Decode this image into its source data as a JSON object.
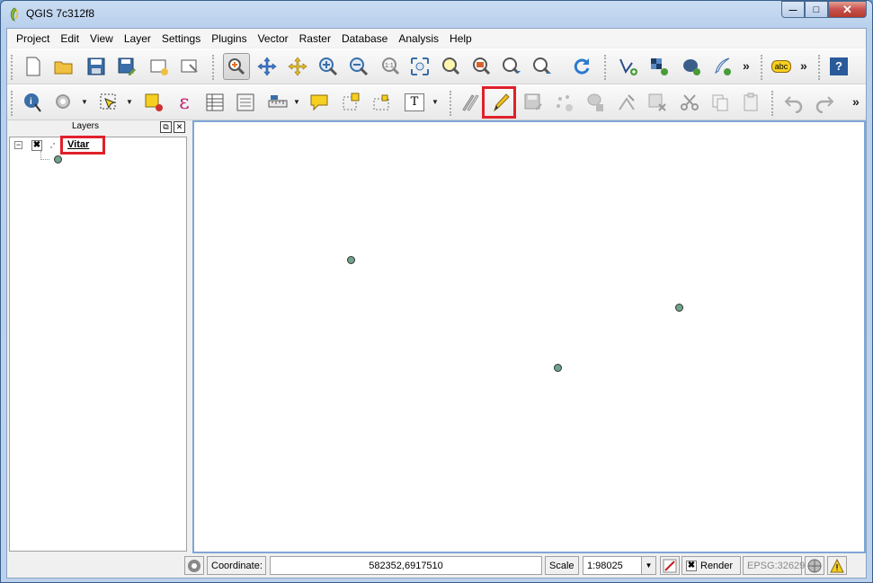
{
  "window": {
    "title": "QGIS 7c312f8",
    "min_glyph": "—",
    "max_glyph": "□",
    "close_glyph": "✕"
  },
  "menu": [
    "Project",
    "Edit",
    "View",
    "Layer",
    "Settings",
    "Plugins",
    "Vector",
    "Raster",
    "Database",
    "Analysis",
    "Help"
  ],
  "toolbar1": {
    "overflow_glyph": "»",
    "label_icon_text": "abc",
    "help_icon_text": "?",
    "buttons": [
      "new-project-icon",
      "open-project-icon",
      "save-project-icon",
      "save-as-icon",
      "new-print-composer-icon",
      "composer-manager-icon",
      "pan-map-icon",
      "pan-to-selection-icon",
      "zoom-in-icon",
      "zoom-out-icon",
      "zoom-actual-size-icon",
      "zoom-full-icon",
      "zoom-to-selection-icon",
      "zoom-to-layer-icon",
      "zoom-last-icon",
      "zoom-next-icon",
      "refresh-icon",
      "add-vector-layer-icon",
      "add-raster-layer-icon",
      "add-postgis-layer-icon",
      "new-shapefile-layer-icon",
      "label-tool-icon",
      "help-icon"
    ]
  },
  "toolbar2": {
    "overflow_glyph": "»",
    "text_icon_glyph": "T",
    "expression_glyph": "ε",
    "highlighted_button": "toggle-editing-icon",
    "buttons": [
      "identify-features-icon",
      "run-feature-action-icon",
      "select-features-icon",
      "deselect-all-icon",
      "select-by-expression-icon",
      "open-attribute-table-icon",
      "field-calculator-icon",
      "measure-icon",
      "map-tips-icon",
      "new-bookmark-icon",
      "show-bookmarks-icon",
      "text-annotation-icon",
      "current-edits-icon",
      "toggle-editing-icon",
      "save-layer-edits-icon",
      "add-feature-icon",
      "move-feature-icon",
      "node-tool-icon",
      "delete-selected-icon",
      "cut-features-icon",
      "copy-features-icon",
      "paste-features-icon",
      "undo-icon",
      "redo-icon"
    ]
  },
  "layers_panel": {
    "title": "Layers",
    "float_glyph": "⧉",
    "close_glyph": "✕",
    "expander_glyph": "−",
    "check_glyph": "✖",
    "layer_name": "Vitar"
  },
  "map": {
    "feature_count": 3,
    "feature_color": "#6fa38a"
  },
  "statusbar": {
    "coordinate_label": "Coordinate:",
    "coordinate_value": "582352,6917510",
    "scale_label": "Scale",
    "scale_value": "1:98025",
    "combo_arrow": "▼",
    "render_check_glyph": "✖",
    "render_label": "Render",
    "crs": "EPSG:32629"
  },
  "colors": {
    "highlight": "#e0202a",
    "canvas_border": "#7fa6d6"
  }
}
